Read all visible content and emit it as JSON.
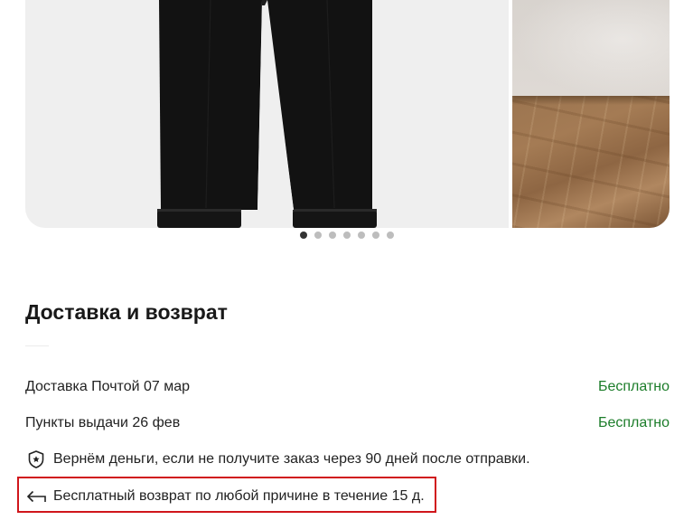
{
  "gallery": {
    "slide_count": 7,
    "active_index": 0,
    "images": [
      "black-trousers-photo",
      "wooden-floor-photo"
    ]
  },
  "delivery": {
    "title": "Доставка и возврат",
    "options": [
      {
        "label": "Доставка Почтой 07 мар",
        "price": "Бесплатно"
      },
      {
        "label": "Пункты выдачи 26 фев",
        "price": "Бесплатно"
      }
    ],
    "guarantee": {
      "icon": "shield-icon",
      "text": "Вернём деньги, если не получите заказ через 90 дней после отправки."
    },
    "return_policy": {
      "icon": "return-arrow-icon",
      "text": "Бесплатный возврат по любой причине в течение 15 д."
    }
  },
  "colors": {
    "free_price": "#1c7d2a",
    "highlight": "#d0161b",
    "active_dot": "#333333"
  }
}
